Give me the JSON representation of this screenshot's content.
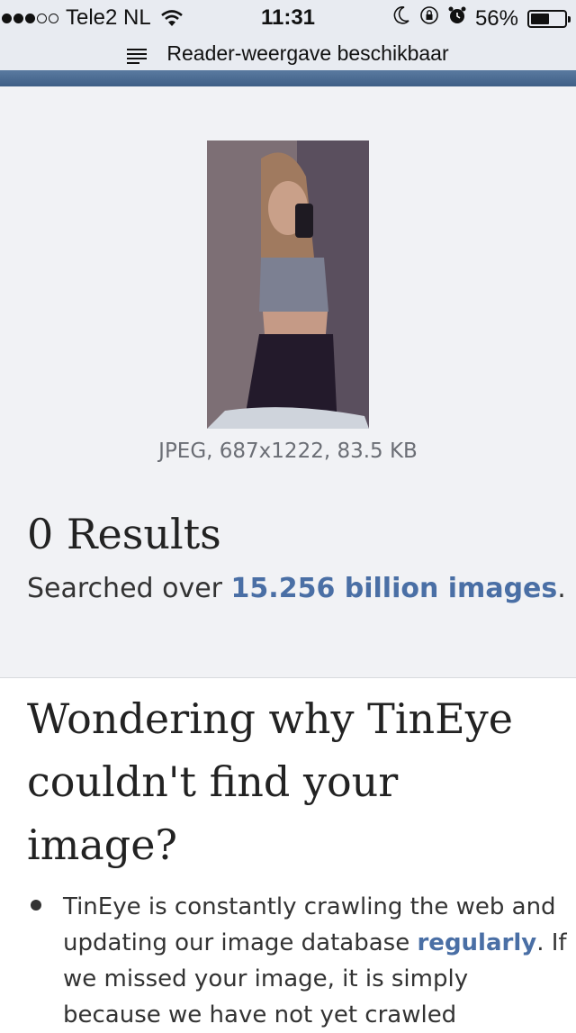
{
  "status_bar": {
    "carrier": "Tele2 NL",
    "time": "11:31",
    "battery": "56%",
    "battery_level": 0.56,
    "icons": [
      "signal-dots-icon",
      "wifi-icon",
      "moon-icon",
      "rotation-lock-icon",
      "alarm-icon",
      "battery-icon"
    ]
  },
  "reader_bar": {
    "label": "Reader-weergave beschikbaar",
    "icon": "reader-view-icon"
  },
  "image_info": {
    "meta": "JPEG, 687x1222, 83.5 KB"
  },
  "results": {
    "title": "0 Results",
    "searched_prefix": "Searched over ",
    "searched_count": "15.256 billion images",
    "searched_suffix": "."
  },
  "help": {
    "heading": "Wondering why TinEye couldn't find your image?",
    "bullet_1_part1": "TinEye is constantly crawling the web and updating our image database ",
    "bullet_1_link": "regularly",
    "bullet_1_part2": ". If we missed your image, it is simply because we have not yet crawled"
  },
  "colors": {
    "link": "#4a6fa5",
    "header_strip": "#4b6b93",
    "section_bg": "#f1f2f5"
  }
}
